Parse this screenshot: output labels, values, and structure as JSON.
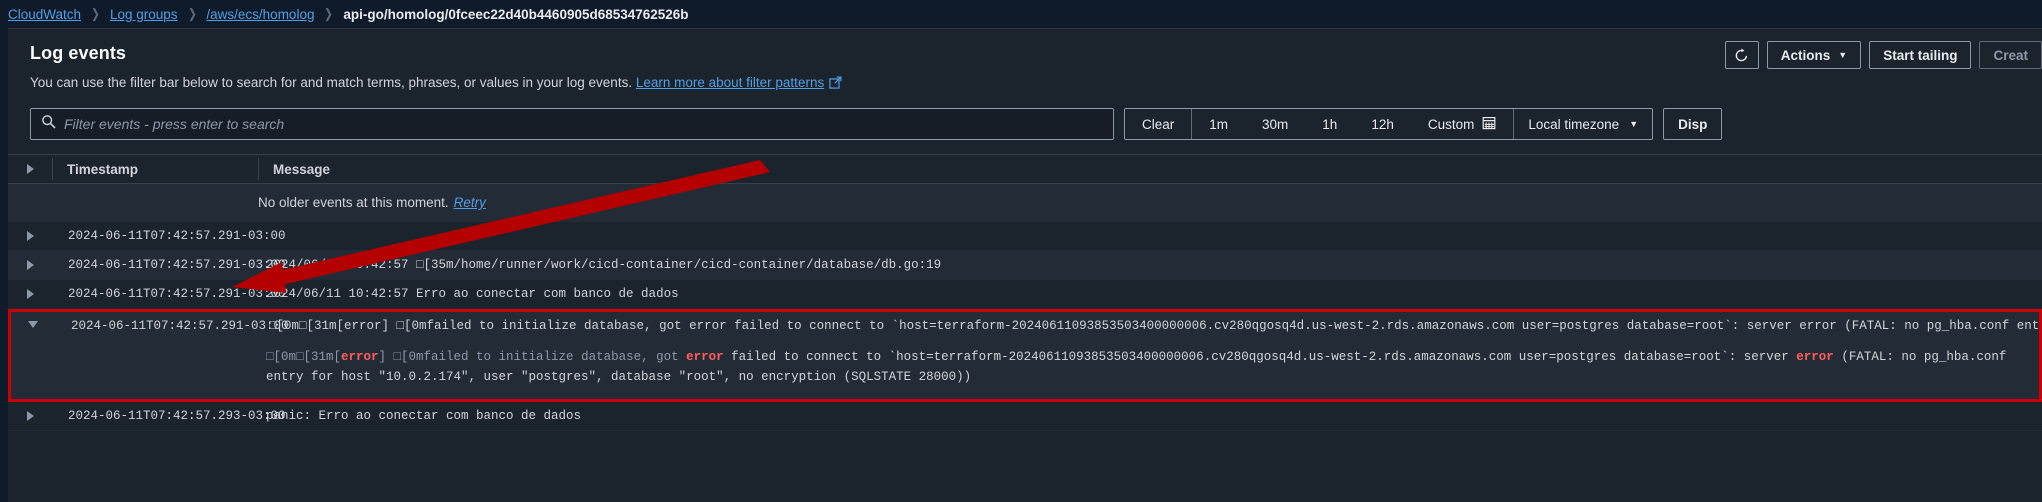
{
  "breadcrumb": {
    "items": [
      {
        "label": "CloudWatch",
        "current": false
      },
      {
        "label": "Log groups",
        "current": false
      },
      {
        "label": "/aws/ecs/homolog",
        "current": false
      },
      {
        "label": "api-go/homolog/0fceec22d40b4460905d68534762526b",
        "current": true
      }
    ],
    "separator": "❯"
  },
  "header": {
    "title": "Log events",
    "description_before_link": "You can use the filter bar below to search for and match terms, phrases, or values in your log events.",
    "link_text": "Learn more about filter patterns",
    "refresh_label": "↻",
    "actions_label": "Actions",
    "actions_caret": "▼",
    "start_tailing_label": "Start tailing",
    "create_label": "Creat"
  },
  "filter": {
    "placeholder": "Filter events - press enter to search",
    "value": "",
    "search_icon": "search-icon",
    "ranges": [
      {
        "label": "Clear"
      },
      {
        "label": "1m"
      },
      {
        "label": "30m"
      },
      {
        "label": "1h"
      },
      {
        "label": "12h"
      },
      {
        "label": "Custom",
        "icon": "calendar-icon"
      }
    ],
    "timezone_label": "Local timezone",
    "timezone_caret": "▼",
    "display_label": "Disp"
  },
  "table": {
    "columns": {
      "expand": "",
      "timestamp": "Timestamp",
      "message": "Message"
    },
    "notice": {
      "text": "No older events at this moment.",
      "retry_label": "Retry"
    },
    "rows": [
      {
        "timestamp": "2024-06-11T07:42:57.291-03:00",
        "message": "",
        "expanded": false
      },
      {
        "timestamp": "2024-06-11T07:42:57.291-03:00",
        "message": "2024/06/11 10:42:57 □[35m/home/runner/work/cicd-container/cicd-container/database/db.go:19",
        "expanded": false
      },
      {
        "timestamp": "2024-06-11T07:42:57.291-03:00",
        "message": "2024/06/11 10:42:57 Erro ao conectar com banco de dados",
        "expanded": false
      },
      {
        "timestamp": "2024-06-11T07:42:57.291-03:00",
        "message": "□[0m□[31m[error] □[0mfailed to initialize database, got error failed to connect to `host=terraform-20240611093853503400000006.cv280qgosq4d.us-west-2.rds.amazonaws.com user=postgres database=root`: server error (FATAL: no pg_hba.conf ent",
        "expanded": true,
        "detail_segments": [
          {
            "text": "□[0m□[31m[",
            "kind": "ansi"
          },
          {
            "text": "error",
            "kind": "error"
          },
          {
            "text": "] □[0mfailed to initialize database, got ",
            "kind": "ansi"
          },
          {
            "text": "error",
            "kind": "error"
          },
          {
            "text": " failed to connect to `host=terraform-20240611093853503400000006.cv280qgosq4d.us-west-2.rds.amazonaws.com user=postgres database=root`: server ",
            "kind": "normal"
          },
          {
            "text": "error",
            "kind": "error"
          },
          {
            "text": " (FATAL: no pg_hba.conf entry for host \"10.0.2.174\", user \"postgres\", database \"root\", no encryption (SQLSTATE 28000))",
            "kind": "normal"
          }
        ]
      },
      {
        "timestamp": "2024-06-11T07:42:57.293-03:00",
        "message": "panic: Erro ao conectar com banco de dados",
        "expanded": false
      }
    ]
  },
  "annotation": {
    "arrow_color": "#b40000",
    "highlight_color": "#cc0000"
  }
}
